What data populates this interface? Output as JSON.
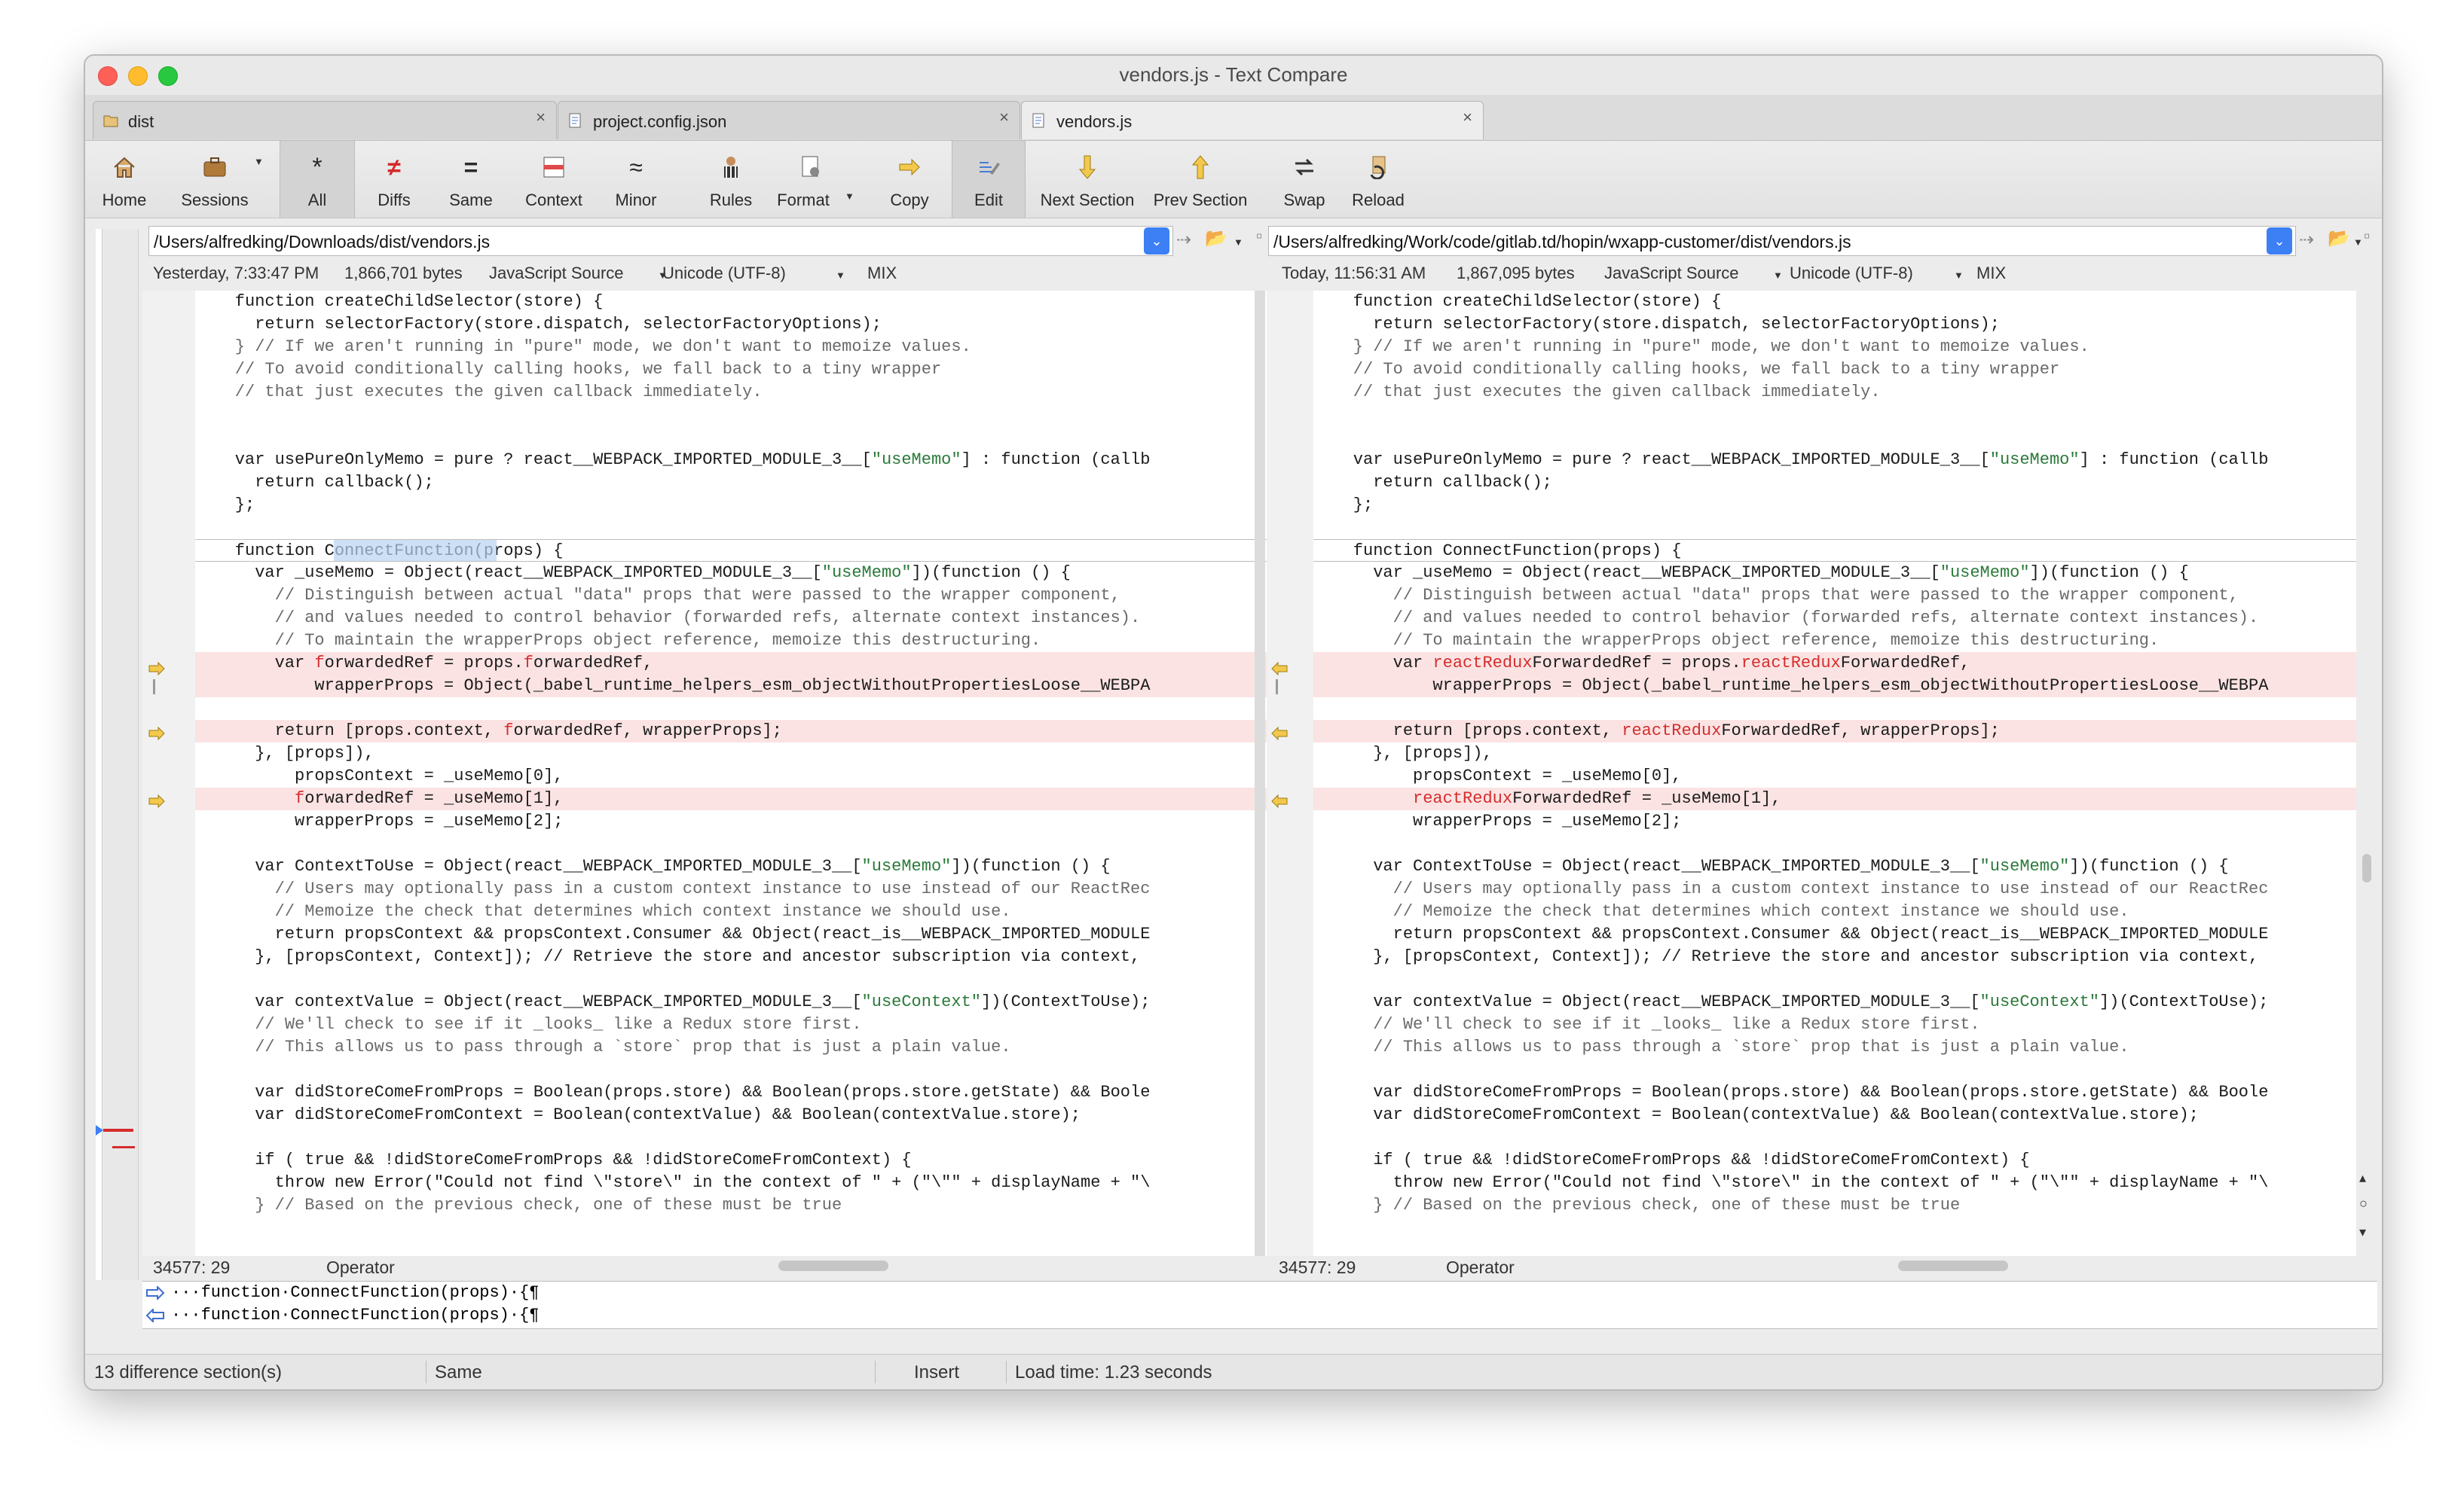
{
  "window": {
    "title": "vendors.js - Text Compare"
  },
  "tabs": [
    {
      "label": "dist"
    },
    {
      "label": "project.config.json"
    },
    {
      "label": "vendors.js"
    }
  ],
  "toolbar": {
    "home": "Home",
    "sessions": "Sessions",
    "all": "All",
    "diffs": "Diffs",
    "same": "Same",
    "context": "Context",
    "minor": "Minor",
    "rules": "Rules",
    "format": "Format",
    "copy": "Copy",
    "edit": "Edit",
    "next_section": "Next Section",
    "prev_section": "Prev Section",
    "swap": "Swap",
    "reload": "Reload"
  },
  "left": {
    "path": "/Users/alfredking/Downloads/dist/vendors.js",
    "date": "Yesterday, 7:33:47 PM",
    "size": "1,866,701 bytes",
    "format": "JavaScript Source",
    "encoding": "Unicode (UTF-8)",
    "lineend": "MIX",
    "position": "34577: 29",
    "token": "Operator"
  },
  "right": {
    "path": "/Users/alfredking/Work/code/gitlab.td/hopin/wxapp-customer/dist/vendors.js",
    "date": "Today, 11:56:31 AM",
    "size": "1,867,095 bytes",
    "format": "JavaScript Source",
    "encoding": "Unicode (UTF-8)",
    "lineend": "MIX",
    "position": "34577: 29",
    "token": "Operator"
  },
  "code": {
    "l01": "    function createChildSelector(store) {",
    "l02": "      return selectorFactory(store.dispatch, selectorFactoryOptions);",
    "l03": "    } // If we aren't running in \"pure\" mode, we don't want to memoize values.",
    "l04": "    // To avoid conditionally calling hooks, we fall back to a tiny wrapper",
    "l05": "    // that just executes the given callback immediately.",
    "l08": "    var usePureOnlyMemo = pure ? react__WEBPACK_IMPORTED_MODULE_3__[\"useMemo\"] : function (callb",
    "l09": "      return callback();",
    "l10": "    };",
    "l12": "    function ConnectFunction(props) {",
    "l13": "      var _useMemo = Object(react__WEBPACK_IMPORTED_MODULE_3__[\"useMemo\"])(function () {",
    "l14": "        // Distinguish between actual \"data\" props that were passed to the wrapper component,",
    "l15": "        // and values needed to control behavior (forwarded refs, alternate context instances).",
    "l16": "        // To maintain the wrapperProps object reference, memoize this destructuring.",
    "l17L": "        var forwardedRef = props.forwardedRef,",
    "l17R": "        var reactReduxForwardedRef = props.reactReduxForwardedRef,",
    "l18": "            wrapperProps = Object(_babel_runtime_helpers_esm_objectWithoutPropertiesLoose__WEBPA",
    "l20L": "        return [props.context, forwardedRef, wrapperProps];",
    "l20R": "        return [props.context, reactReduxForwardedRef, wrapperProps];",
    "l21": "      }, [props]),",
    "l22": "          propsContext = _useMemo[0],",
    "l23L": "          forwardedRef = _useMemo[1],",
    "l23R": "          reactReduxForwardedRef = _useMemo[1],",
    "l24": "          wrapperProps = _useMemo[2];",
    "l26": "      var ContextToUse = Object(react__WEBPACK_IMPORTED_MODULE_3__[\"useMemo\"])(function () {",
    "l27": "        // Users may optionally pass in a custom context instance to use instead of our ReactRec",
    "l28": "        // Memoize the check that determines which context instance we should use.",
    "l29": "        return propsContext && propsContext.Consumer && Object(react_is__WEBPACK_IMPORTED_MODULE",
    "l30": "      }, [propsContext, Context]); // Retrieve the store and ancestor subscription via context,",
    "l32": "      var contextValue = Object(react__WEBPACK_IMPORTED_MODULE_3__[\"useContext\"])(ContextToUse);",
    "l33": "      // We'll check to see if it _looks_ like a Redux store first.",
    "l34": "      // This allows us to pass through a `store` prop that is just a plain value.",
    "l36": "      var didStoreComeFromProps = Boolean(props.store) && Boolean(props.store.getState) && Boole",
    "l37": "      var didStoreComeFromContext = Boolean(contextValue) && Boolean(contextValue.store);",
    "l39": "      if ( true && !didStoreComeFromProps && !didStoreComeFromContext) {",
    "l40": "        throw new Error(\"Could not find \\\"store\\\" in the context of \" + (\"\\\"\" + displayName + \"\\",
    "l41": "      } // Based on the previous check, one of these must be true"
  },
  "bottom": {
    "line1": "···function·ConnectFunction(props)·{¶",
    "line2": "···function·ConnectFunction(props)·{¶"
  },
  "footer": {
    "sections": "13 difference section(s)",
    "state": "Same",
    "mode": "Insert",
    "load": "Load time: 1.23 seconds"
  },
  "colors": {
    "diff_bg": "#fbe3e3",
    "diff_text": "#d52d2d",
    "accent": "#3d7ff5",
    "string": "#2a7a3a"
  }
}
